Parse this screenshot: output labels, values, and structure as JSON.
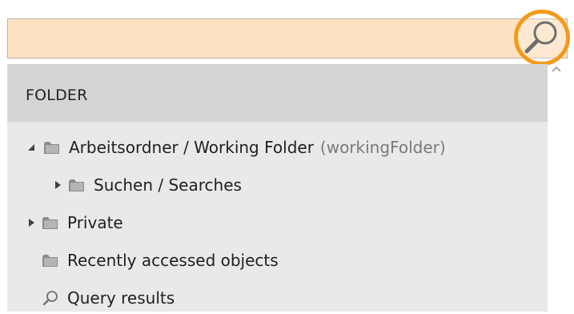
{
  "search": {
    "value": "",
    "placeholder": "",
    "button_icon": "magnifier-icon",
    "highlight_color": "#f39a1b",
    "background_color": "#fde2c2"
  },
  "panel": {
    "header": "FOLDER",
    "tree": [
      {
        "label": "Arbeitsordner / Working Folder",
        "sub_label": "(workingFolder)",
        "expanded": true,
        "level": 0,
        "icon": "folder-icon"
      },
      {
        "label": "Suchen / Searches",
        "expanded": false,
        "level": 1,
        "icon": "folder-icon"
      },
      {
        "label": "Private",
        "expanded": false,
        "level": 0,
        "icon": "folder-icon"
      },
      {
        "label": "Recently accessed objects",
        "level": 0,
        "icon": "folder-icon"
      },
      {
        "label": "Query results",
        "level": 0,
        "icon": "magnifier-icon"
      }
    ]
  }
}
